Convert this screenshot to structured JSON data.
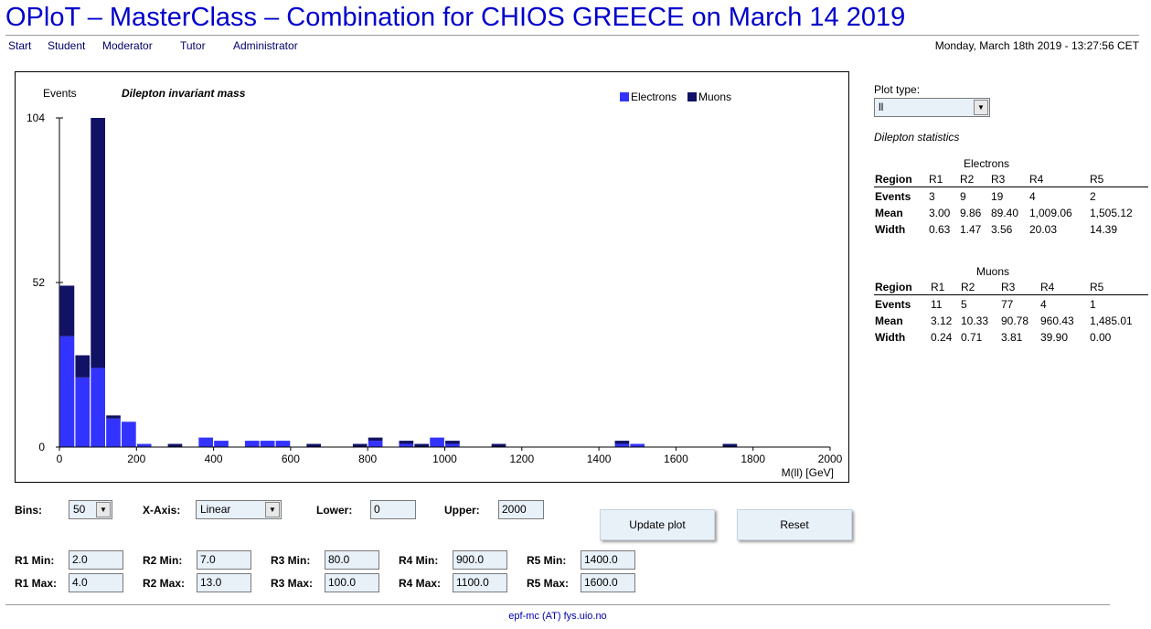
{
  "header": {
    "title": "OPloT – MasterClass – Combination for CHIOS GREECE on March 14 2019",
    "datetime": "Monday, March 18th 2019 - 13:27:56 CET"
  },
  "nav": {
    "items": [
      "Start",
      "Student",
      "Moderator",
      "Tutor",
      "Administrator"
    ]
  },
  "chart_data": {
    "type": "bar",
    "stacked": true,
    "title": "Dilepton invariant mass",
    "ylabel": "Events",
    "xlabel": "M(ll) [GeV]",
    "xlim": [
      0,
      2000
    ],
    "ylim": [
      0,
      104
    ],
    "x_ticks": [
      0,
      200,
      400,
      600,
      800,
      1000,
      1200,
      1400,
      1600,
      1800,
      2000
    ],
    "y_ticks": [
      0,
      52,
      104
    ],
    "legend_position": "top-right",
    "bin_width": 40,
    "bin_starts": [
      0,
      40,
      80,
      120,
      160,
      200,
      280,
      360,
      400,
      480,
      520,
      560,
      640,
      760,
      800,
      880,
      920,
      960,
      1000,
      1120,
      1440,
      1480,
      1720
    ],
    "series": [
      {
        "name": "Electrons",
        "color": "#3333ff",
        "values": [
          35,
          22,
          25,
          9,
          8,
          1,
          0,
          3,
          2,
          2,
          2,
          2,
          0,
          0,
          2,
          1,
          0,
          3,
          1,
          0,
          1,
          1,
          0
        ]
      },
      {
        "name": "Muons",
        "color": "#111166",
        "values": [
          16,
          7,
          79,
          1,
          0,
          0,
          1,
          0,
          0,
          0,
          0,
          0,
          1,
          1,
          1,
          1,
          1,
          0,
          1,
          1,
          1,
          0,
          1
        ]
      }
    ]
  },
  "sidebar": {
    "plot_type_label": "Plot type:",
    "plot_type_value": "ll",
    "stats_title": "Dilepton statistics",
    "electrons": {
      "caption": "Electrons",
      "headers": [
        "Region",
        "R1",
        "R2",
        "R3",
        "R4",
        "R5"
      ],
      "rows": [
        [
          "Events",
          "3",
          "9",
          "19",
          "4",
          "2"
        ],
        [
          "Mean",
          "3.00",
          "9.86",
          "89.40",
          "1,009.06",
          "1,505.12"
        ],
        [
          "Width",
          "0.63",
          "1.47",
          "3.56",
          "20.03",
          "14.39"
        ]
      ]
    },
    "muons": {
      "caption": "Muons",
      "headers": [
        "Region",
        "R1",
        "R2",
        "R3",
        "R4",
        "R5"
      ],
      "rows": [
        [
          "Events",
          "11",
          "5",
          "77",
          "4",
          "1"
        ],
        [
          "Mean",
          "3.12",
          "10.33",
          "90.78",
          "960.43",
          "1,485.01"
        ],
        [
          "Width",
          "0.24",
          "0.71",
          "3.81",
          "39.90",
          "0.00"
        ]
      ]
    }
  },
  "controls": {
    "bins_label": "Bins:",
    "bins_value": "50",
    "xaxis_label": "X-Axis:",
    "xaxis_value": "Linear",
    "lower_label": "Lower:",
    "lower_value": "0",
    "upper_label": "Upper:",
    "upper_value": "2000",
    "update_button": "Update plot",
    "reset_button": "Reset",
    "regions": [
      {
        "min_label": "R1 Min:",
        "min": "2.0",
        "max_label": "R1 Max:",
        "max": "4.0"
      },
      {
        "min_label": "R2 Min:",
        "min": "7.0",
        "max_label": "R2 Max:",
        "max": "13.0"
      },
      {
        "min_label": "R3 Min:",
        "min": "80.0",
        "max_label": "R3 Max:",
        "max": "100.0"
      },
      {
        "min_label": "R4 Min:",
        "min": "900.0",
        "max_label": "R4 Max:",
        "max": "1100.0"
      },
      {
        "min_label": "R5 Min:",
        "min": "1400.0",
        "max_label": "R5 Max:",
        "max": "1600.0"
      }
    ]
  },
  "footer": {
    "text": "epf-mc (AT) fys.uio.no"
  }
}
